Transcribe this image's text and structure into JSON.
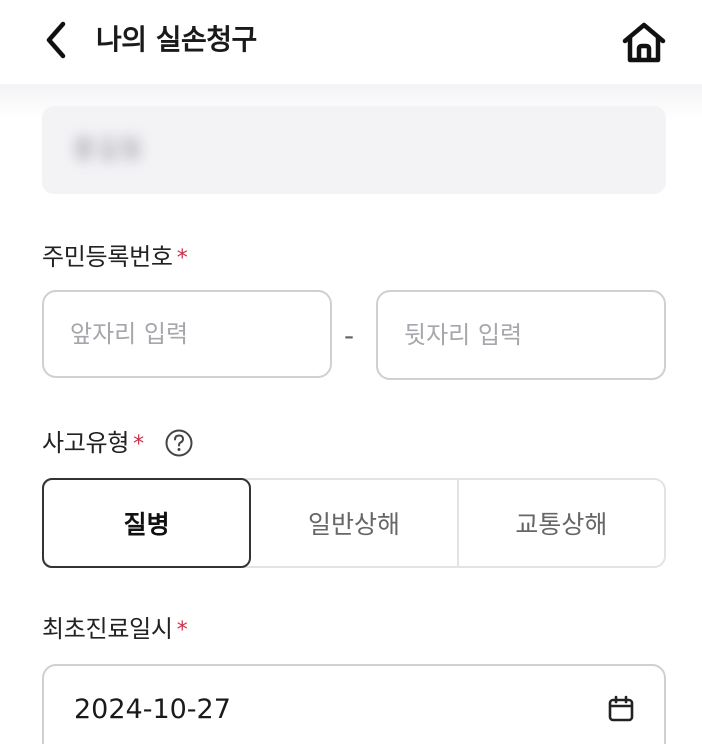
{
  "header": {
    "title": "나의 실손청구",
    "back_icon": "chevron-left-icon",
    "home_icon": "home-icon"
  },
  "name_field": {
    "value": "홍길동"
  },
  "rrn": {
    "label": "주민등록번호",
    "required_mark": "*",
    "front_placeholder": "앞자리 입력",
    "separator": "-",
    "back_placeholder": "뒷자리 입력"
  },
  "accident_type": {
    "label": "사고유형",
    "required_mark": "*",
    "help_icon": "question-circle-icon",
    "options": [
      "질병",
      "일반상해",
      "교통상해"
    ],
    "selected": "질병"
  },
  "first_visit": {
    "label": "최초진료일시",
    "required_mark": "*",
    "value": "2024-10-27",
    "icon": "calendar-icon"
  },
  "colors": {
    "required": "#c8324a",
    "active_border": "#333333",
    "input_border": "#cfcfd4",
    "name_field_bg": "#f3f3f6"
  }
}
